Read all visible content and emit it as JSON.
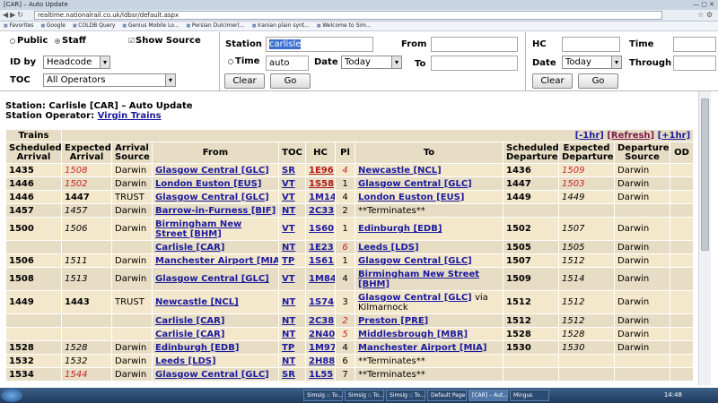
{
  "browser": {
    "tab_title": "[CAR] – Auto Update",
    "url": "realtime.nationalrail.co.uk/ldbsr/default.aspx",
    "bookmarks": [
      "Favorites",
      "Google",
      "COLDB Query",
      "Genius Mobile Lo...",
      "Persian Dulcimer(...",
      "Iranian plain synt...",
      "Welcome to Sim..."
    ]
  },
  "form": {
    "public_label": "Public",
    "staff_label": "Staff",
    "show_source_label": "Show Source",
    "id_by_label": "ID by",
    "id_by_value": "Headcode",
    "toc_label": "TOC",
    "toc_value": "All Operators",
    "station_label": "Station",
    "station_value": "carlisle",
    "time_label": "Time",
    "time_value": "auto",
    "date_label": "Date",
    "date_value": "Today",
    "from_label": "From",
    "to_label": "To",
    "clear_label": "Clear",
    "go_label": "Go",
    "hc_label": "HC",
    "time2_label": "Time",
    "date2_label": "Date",
    "date2_value": "Today",
    "through_label": "Through",
    "clear2_label": "Clear",
    "go2_label": "Go"
  },
  "station": {
    "line1": "Station: Carlisle [CAR] – Auto Update",
    "operator_prefix": "Station Operator: ",
    "operator": "Virgin Trains"
  },
  "table": {
    "trains_label": "Trains",
    "prev_link": "[-1hr]",
    "refresh_link": "[Refresh]",
    "next_link": "[+1hr]",
    "headers": [
      "Scheduled Arrival",
      "Expected Arrival",
      "Arrival Source",
      "From",
      "TOC",
      "HC",
      "Pl",
      "To",
      "Scheduled Departure",
      "Expected Departure",
      "Departure Source",
      "OD"
    ],
    "rows": [
      {
        "sa": "1435",
        "ea": "1508",
        "ea_style": "late",
        "as": "Darwin",
        "from": "Glasgow Central [GLC]",
        "toc": "SR",
        "hc": "1E96",
        "hc_red": true,
        "pl": "4",
        "pl_style": "late",
        "to": "Newcastle [NCL]",
        "to_extra": "",
        "sd": "1436",
        "ed": "1509",
        "ed_style": "late",
        "ds": "Darwin"
      },
      {
        "sa": "1446",
        "ea": "1502",
        "ea_style": "late",
        "as": "Darwin",
        "from": "London Euston [EUS]",
        "toc": "VT",
        "hc": "1S58",
        "hc_red": true,
        "pl": "1",
        "pl_style": "",
        "to": "Glasgow Central [GLC]",
        "to_extra": "",
        "sd": "1447",
        "ed": "1503",
        "ed_style": "late",
        "ds": "Darwin"
      },
      {
        "sa": "1446",
        "ea": "1447",
        "ea_style": "bold",
        "as": "TRUST",
        "from": "Glasgow Central [GLC]",
        "toc": "VT",
        "hc": "1M14",
        "hc_red": false,
        "pl": "4",
        "pl_style": "",
        "to": "London Euston [EUS]",
        "to_extra": "",
        "sd": "1449",
        "ed": "1449",
        "ed_style": "est",
        "ds": "Darwin"
      },
      {
        "sa": "1457",
        "ea": "1457",
        "ea_style": "est",
        "as": "Darwin",
        "from": "Barrow-in-Furness [BIF]",
        "toc": "NT",
        "hc": "2C33",
        "hc_red": false,
        "pl": "2",
        "pl_style": "",
        "to": "**Terminates**",
        "to_extra": "",
        "sd": "",
        "ed": "",
        "ed_style": "",
        "ds": ""
      },
      {
        "sa": "1500",
        "ea": "1506",
        "ea_style": "est",
        "as": "Darwin",
        "from": "Birmingham New Street [BHM]",
        "toc": "VT",
        "hc": "1S60",
        "hc_red": false,
        "pl": "1",
        "pl_style": "",
        "to": "Edinburgh [EDB]",
        "to_extra": "",
        "sd": "1502",
        "ed": "1507",
        "ed_style": "est",
        "ds": "Darwin",
        "tall": true
      },
      {
        "sa": "",
        "ea": "",
        "ea_style": "",
        "as": "",
        "from": "Carlisle [CAR]",
        "toc": "NT",
        "hc": "1E23",
        "hc_red": false,
        "pl": "6",
        "pl_style": "late",
        "to": "Leeds [LDS]",
        "to_extra": "",
        "sd": "1505",
        "ed": "1505",
        "ed_style": "est",
        "ds": "Darwin"
      },
      {
        "sa": "1506",
        "ea": "1511",
        "ea_style": "est",
        "as": "Darwin",
        "from": "Manchester Airport [MIA]",
        "toc": "TP",
        "hc": "1S61",
        "hc_red": false,
        "pl": "1",
        "pl_style": "",
        "to": "Glasgow Central [GLC]",
        "to_extra": "",
        "sd": "1507",
        "ed": "1512",
        "ed_style": "est",
        "ds": "Darwin"
      },
      {
        "sa": "1508",
        "ea": "1513",
        "ea_style": "est",
        "as": "Darwin",
        "from": "Glasgow Central [GLC]",
        "toc": "VT",
        "hc": "1M84",
        "hc_red": false,
        "pl": "4",
        "pl_style": "",
        "to": "Birmingham New Street [BHM]",
        "to_extra": "",
        "sd": "1509",
        "ed": "1514",
        "ed_style": "est",
        "ds": "Darwin",
        "tall": true
      },
      {
        "sa": "1449",
        "ea": "1443",
        "ea_style": "bold",
        "as": "TRUST",
        "from": "Newcastle [NCL]",
        "toc": "NT",
        "hc": "1S74",
        "hc_red": false,
        "pl": "3",
        "pl_style": "",
        "to": "Glasgow Central [GLC]",
        "to_extra": " via Kilmarnock",
        "sd": "1512",
        "ed": "1512",
        "ed_style": "est",
        "ds": "Darwin",
        "tall": true
      },
      {
        "sa": "",
        "ea": "",
        "ea_style": "",
        "as": "",
        "from": "Carlisle [CAR]",
        "toc": "NT",
        "hc": "2C38",
        "hc_red": false,
        "pl": "2",
        "pl_style": "late",
        "to": "Preston [PRE]",
        "to_extra": "",
        "sd": "1512",
        "ed": "1512",
        "ed_style": "est",
        "ds": "Darwin"
      },
      {
        "sa": "",
        "ea": "",
        "ea_style": "",
        "as": "",
        "from": "Carlisle [CAR]",
        "toc": "NT",
        "hc": "2N40",
        "hc_red": false,
        "pl": "5",
        "pl_style": "late",
        "to": "Middlesbrough [MBR]",
        "to_extra": "",
        "sd": "1528",
        "ed": "1528",
        "ed_style": "est",
        "ds": "Darwin"
      },
      {
        "sa": "1528",
        "ea": "1528",
        "ea_style": "est",
        "as": "Darwin",
        "from": "Edinburgh [EDB]",
        "toc": "TP",
        "hc": "1M97",
        "hc_red": false,
        "pl": "4",
        "pl_style": "",
        "to": "Manchester Airport [MIA]",
        "to_extra": "",
        "sd": "1530",
        "ed": "1530",
        "ed_style": "est",
        "ds": "Darwin"
      },
      {
        "sa": "1532",
        "ea": "1532",
        "ea_style": "est",
        "as": "Darwin",
        "from": "Leeds [LDS]",
        "toc": "NT",
        "hc": "2H88",
        "hc_red": false,
        "pl": "6",
        "pl_style": "",
        "to": "**Terminates**",
        "to_extra": "",
        "sd": "",
        "ed": "",
        "ed_style": "",
        "ds": ""
      },
      {
        "sa": "1534",
        "ea": "1544",
        "ea_style": "late",
        "as": "Darwin",
        "from": "Glasgow Central [GLC]",
        "toc": "SR",
        "hc": "1L55",
        "hc_red": false,
        "pl": "7",
        "pl_style": "",
        "to": "**Terminates**",
        "to_extra": "",
        "sd": "",
        "ed": "",
        "ed_style": "",
        "ds": ""
      }
    ]
  },
  "taskbar": {
    "tasks": [
      "Simsig :: To...",
      "Simsig :: To...",
      "Simsig :: To...",
      "Default Page...",
      "[CAR] – Aut...",
      "Mingus"
    ],
    "clock": "14:48"
  }
}
